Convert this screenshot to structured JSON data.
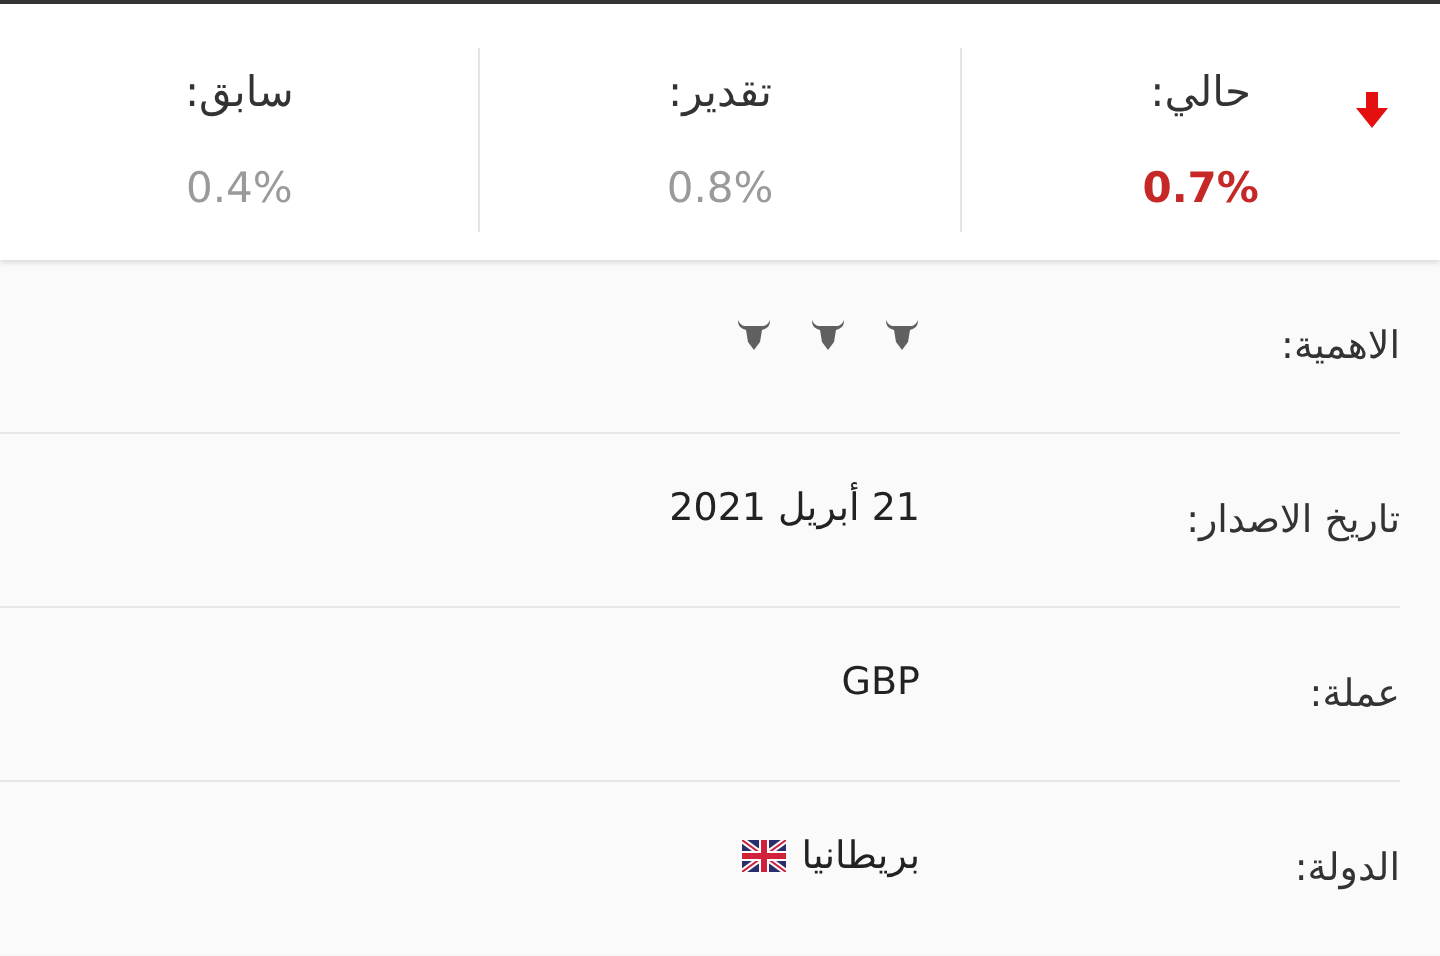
{
  "summary": [
    {
      "label": "حالي:",
      "value": "0.7%",
      "falling": true
    },
    {
      "label": "تقدير:",
      "value": "0.8%"
    },
    {
      "label": "سابق:",
      "value": "0.4%"
    }
  ],
  "details": [
    {
      "kind": "bulls",
      "label": "الاهمية:",
      "stars": 3
    },
    {
      "kind": "text",
      "label": "تاريخ الاصدار:",
      "value": "21 أبريل 2021"
    },
    {
      "kind": "text",
      "label": "عملة:",
      "value": "GBP"
    },
    {
      "kind": "flag",
      "label": "الدولة:",
      "value": "بريطانيا"
    }
  ]
}
